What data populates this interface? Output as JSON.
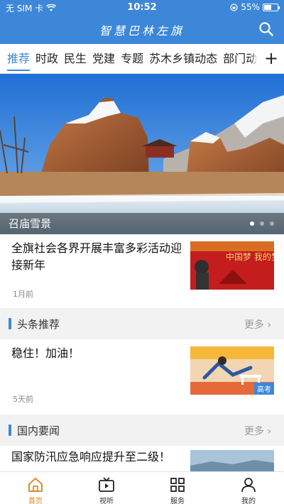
{
  "status_bar": {
    "carrier": "无 SIM 卡",
    "time": "10:52",
    "battery": "55%",
    "battery_level": 0.55
  },
  "header": {
    "title": "智慧巴林左旗",
    "search_icon": "search-icon"
  },
  "tabs": [
    {
      "label": "推荐",
      "active": true
    },
    {
      "label": "时政"
    },
    {
      "label": "民生"
    },
    {
      "label": "党建"
    },
    {
      "label": "专题"
    },
    {
      "label": "苏木乡镇动态"
    },
    {
      "label": "部门动态"
    }
  ],
  "tabs_more": "+",
  "banner": {
    "caption": "召庙雪景",
    "page_count": 3,
    "current_page": 1
  },
  "items": [
    {
      "title": "全旗社会各界开展丰富多彩活动迎接新年",
      "time": "1月前",
      "thumb_text": "中国梦 我的梦"
    }
  ],
  "sections": [
    {
      "name": "头条推荐",
      "more": "更多",
      "items": [
        {
          "title": "稳住！加油！",
          "time": "5天前",
          "thumb_tag": "高考"
        }
      ]
    },
    {
      "name": "国内要闻",
      "more": "更多",
      "items": [
        {
          "title": "国家防汛应急响应提升至二级！"
        }
      ]
    }
  ],
  "tabbar": [
    {
      "label": "首页",
      "icon": "home-icon",
      "active": true
    },
    {
      "label": "视听",
      "icon": "tv-icon"
    },
    {
      "label": "服务",
      "icon": "grid-icon"
    },
    {
      "label": "我的",
      "icon": "person-icon"
    }
  ],
  "colors": {
    "brand_blue": "#3d87d9",
    "active_tab_orange": "#d9801a"
  }
}
